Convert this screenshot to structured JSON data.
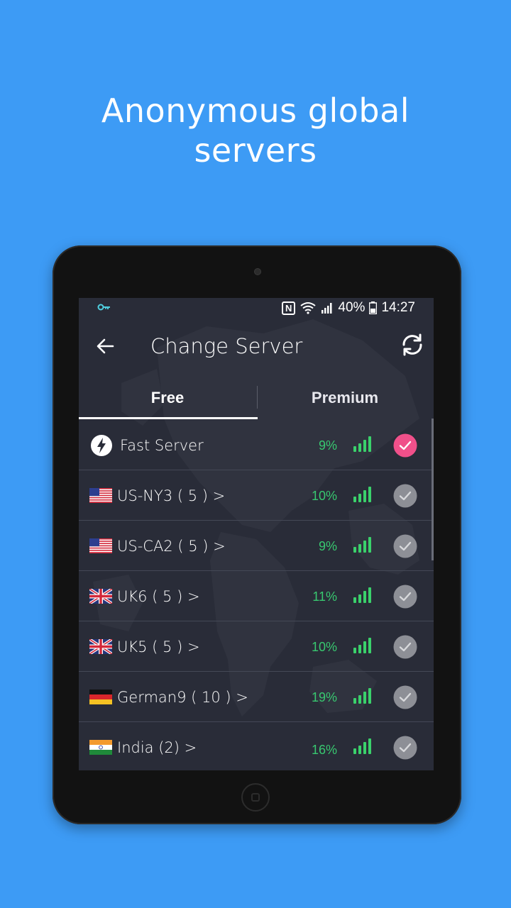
{
  "headline": {
    "line1": "Anonymous global",
    "line2": "servers"
  },
  "status_bar": {
    "nfc": "N",
    "battery": "40%",
    "time": "14:27"
  },
  "app_bar": {
    "title": "Change Server",
    "back_icon": "arrow-left-icon",
    "refresh_icon": "refresh-icon"
  },
  "tabs": [
    {
      "label": "Free",
      "selected": true
    },
    {
      "label": "Premium",
      "selected": false
    }
  ],
  "servers": [
    {
      "name": "Fast Server",
      "load": "9%",
      "flag": "bolt",
      "selected": true,
      "signal_bars": 4
    },
    {
      "name": "US-NY3 ( 5 ) >",
      "load": "10%",
      "flag": "us",
      "selected": false,
      "signal_bars": 4
    },
    {
      "name": "US-CA2 ( 5 ) >",
      "load": "9%",
      "flag": "us",
      "selected": false,
      "signal_bars": 4
    },
    {
      "name": "UK6 ( 5 ) >",
      "load": "11%",
      "flag": "uk",
      "selected": false,
      "signal_bars": 4
    },
    {
      "name": "UK5 ( 5 ) >",
      "load": "10%",
      "flag": "uk",
      "selected": false,
      "signal_bars": 4
    },
    {
      "name": "German9 ( 10 ) >",
      "load": "19%",
      "flag": "de",
      "selected": false,
      "signal_bars": 4
    },
    {
      "name": "India  (2) >",
      "load": "16%",
      "flag": "in",
      "selected": false,
      "signal_bars": 4
    }
  ],
  "colors": {
    "background": "#3d9bf5",
    "screen": "#292c38",
    "load_text": "#38c870",
    "signal": "#3ad16b",
    "selected_check": "#f0508a",
    "unselected_check": "#8d8f96"
  }
}
